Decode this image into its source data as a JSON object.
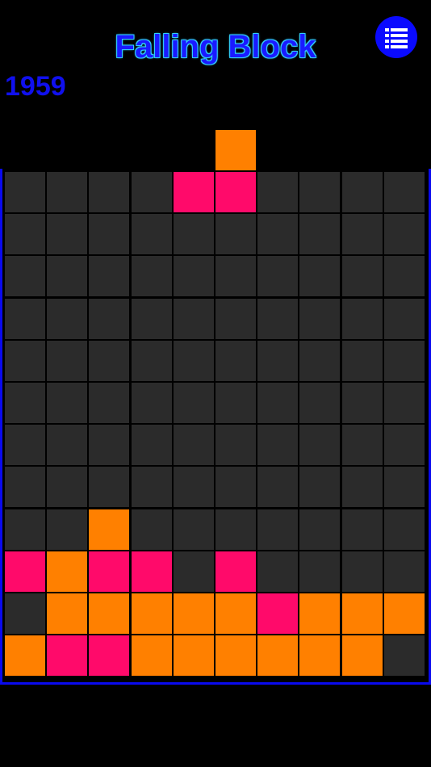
{
  "header": {
    "title": "Falling Block",
    "score": "1959",
    "menu_icon": "list-icon"
  },
  "colors": {
    "empty": "#2b2b2b",
    "orange": "#ff8000",
    "pink": "#ff0a6a",
    "accent": "#0a0aff"
  },
  "board": {
    "columns": 10,
    "rows": 12,
    "cells": [
      "..........",
      "..........",
      "..........",
      "..........",
      "..........",
      "..........",
      "..........",
      "..........",
      "..O.......",
      "POPP.P....",
      ".OOOOOPOOO",
      "OPPOOOOOO."
    ],
    "falling_piece": [
      {
        "row": -1,
        "col": 5,
        "color": "O"
      },
      {
        "row": 0,
        "col": 4,
        "color": "P"
      },
      {
        "row": 0,
        "col": 5,
        "color": "P"
      }
    ]
  }
}
